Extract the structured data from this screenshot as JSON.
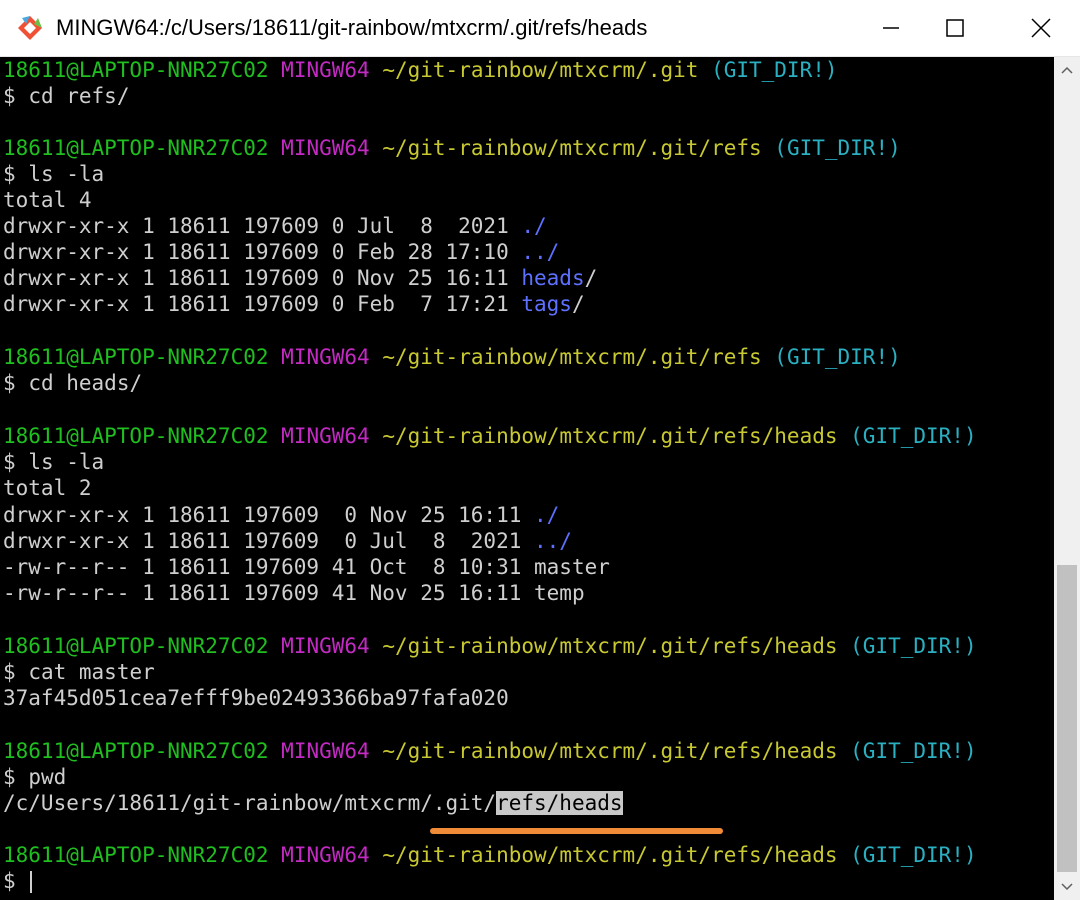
{
  "window": {
    "title": "MINGW64:/c/Users/18611/git-rainbow/mtxcrm/.git/refs/heads"
  },
  "terminal": {
    "colors": {
      "user_host": "#1fbf1f",
      "msystem": "#c32ac3",
      "path": "#c8c832",
      "git_dir": "#2bb0c2",
      "directory": "#5e70ff",
      "text": "#cfcfcf",
      "highlight_bar": "#f08c38"
    },
    "prompt": {
      "user_host": "18611@LAPTOP-NNR27C02",
      "msystem": "MINGW64",
      "git_dir": "(GIT_DIR!)",
      "paths": [
        "~/git-rainbow/mtxcrm/.git",
        "~/git-rainbow/mtxcrm/.git/refs",
        "~/git-rainbow/mtxcrm/.git/refs/heads"
      ],
      "symbol": "$"
    },
    "commands": [
      "cd refs/",
      "ls -la",
      "cd heads/",
      "ls -la",
      "cat master",
      "pwd"
    ],
    "listing1": {
      "total": "total 4",
      "entries": [
        {
          "meta": "drwxr-xr-x 1 18611 197609 0 Jul  8  2021 ",
          "name": "./",
          "kind": "dir"
        },
        {
          "meta": "drwxr-xr-x 1 18611 197609 0 Feb 28 17:10 ",
          "name": "../",
          "kind": "dir"
        },
        {
          "meta": "drwxr-xr-x 1 18611 197609 0 Nov 25 16:11 ",
          "name": "heads",
          "suffix": "/",
          "kind": "dir"
        },
        {
          "meta": "drwxr-xr-x 1 18611 197609 0 Feb  7 17:21 ",
          "name": "tags",
          "suffix": "/",
          "kind": "dir"
        }
      ]
    },
    "listing2": {
      "total": "total 2",
      "entries": [
        {
          "meta": "drwxr-xr-x 1 18611 197609  0 Nov 25 16:11 ",
          "name": "./",
          "kind": "dir"
        },
        {
          "meta": "drwxr-xr-x 1 18611 197609  0 Jul  8  2021 ",
          "name": "../",
          "kind": "dir"
        },
        {
          "meta": "-rw-r--r-- 1 18611 197609 41 Oct  8 10:31 ",
          "name": "master",
          "kind": "file"
        },
        {
          "meta": "-rw-r--r-- 1 18611 197609 41 Nov 25 16:11 ",
          "name": "temp",
          "kind": "file"
        }
      ]
    },
    "cat_output": "37af45d051cea7efff9be02493366ba97fafa020",
    "pwd_output": {
      "prefix": "/c/Users/18611/git-rainbow/mtxcrm/.git/",
      "selected": "refs/heads"
    }
  }
}
